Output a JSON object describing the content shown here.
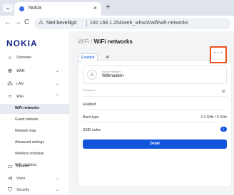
{
  "browser": {
    "tab_title": "Nokia",
    "tab_close": "×",
    "new_tab": "+",
    "security_warning": "Niet beveiligd",
    "url": "192.168.1.254/web_whw/#/wifi/wifi-networks",
    "back": "←",
    "forward": "→",
    "reload": "C"
  },
  "sidebar": {
    "logo": "NOKIA",
    "items": [
      {
        "label": "Overview",
        "icon": "home-icon",
        "glyph": "⌂"
      },
      {
        "label": "WAN",
        "icon": "globe-icon",
        "glyph": "⊕",
        "chevron": "⌄"
      },
      {
        "label": "LAN",
        "icon": "network-icon",
        "glyph": "⁂",
        "chevron": "⌄"
      },
      {
        "label": "WiFi",
        "icon": "wifi-icon",
        "glyph": "≈",
        "chevron": "⌃"
      }
    ],
    "wifi_sub": [
      {
        "label": "WiFi networks"
      },
      {
        "label": "Guest network"
      },
      {
        "label": "Network map"
      },
      {
        "label": "Advanced settings"
      },
      {
        "label": "Wireless schedule"
      },
      {
        "label": "WiFi statistics"
      }
    ],
    "bottom_items": [
      {
        "label": "Devices",
        "icon": "devices-icon",
        "glyph": "▭"
      },
      {
        "label": "Voice",
        "icon": "voice-icon",
        "glyph": "⊲",
        "chevron": "⌄"
      },
      {
        "label": "Security",
        "icon": "shield-icon",
        "glyph": "⛉",
        "chevron": "⌄"
      }
    ]
  },
  "main": {
    "title_prefix": "WiFi / ",
    "title_main": "WiFi networks",
    "tabs": [
      {
        "label": "Enabled"
      },
      {
        "label": "All"
      }
    ],
    "network": {
      "sub_label": "Home Network",
      "name": "Wifimodem",
      "more_label": "···"
    },
    "password_label": "Password",
    "rows": {
      "enabled_label": "Enabled",
      "band_label": "Band type",
      "band_value": "2.4 GHz / 5 GHz",
      "ssid_label": "SSID index",
      "ssid_value": "1"
    },
    "detail_button": "Detail"
  },
  "colors": {
    "brand": "#1b2a8a",
    "accent": "#1155dd",
    "highlight": "#e8541c"
  }
}
